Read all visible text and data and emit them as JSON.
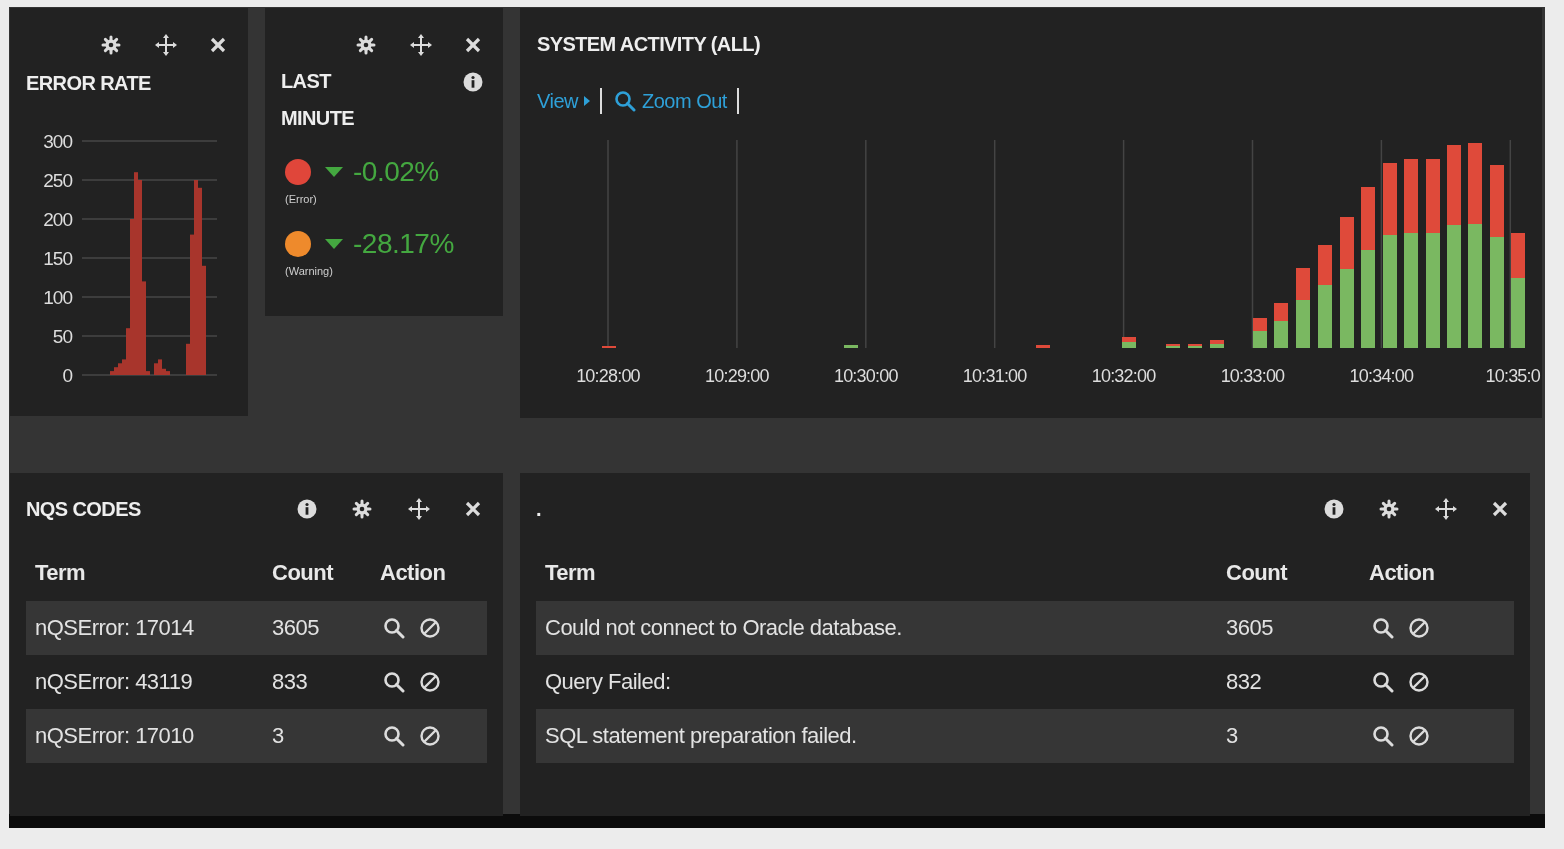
{
  "error_rate": {
    "title": "ERROR RATE",
    "chart_data": {
      "type": "bar",
      "grid": true,
      "ylim": [
        0,
        300
      ],
      "yticks": [
        0,
        50,
        100,
        150,
        200,
        250,
        300
      ],
      "values": [
        0,
        0,
        0,
        0,
        0,
        0,
        0,
        5,
        10,
        15,
        20,
        60,
        200,
        260,
        250,
        120,
        5,
        0,
        15,
        20,
        8,
        5,
        0,
        0,
        0,
        0,
        40,
        180,
        250,
        240,
        140,
        0,
        0,
        0
      ]
    }
  },
  "last_minute": {
    "title": "LAST MINUTE",
    "metrics": [
      {
        "color": "#e0463a",
        "kind": "down",
        "value": "-0.02%",
        "label": "(Error)"
      },
      {
        "color": "#ee8a2c",
        "kind": "down",
        "value": "-28.17%",
        "label": "(Warning)"
      }
    ]
  },
  "system_activity": {
    "title": "SYSTEM ACTIVITY (ALL)",
    "links": [
      {
        "label": "View",
        "kind": "menu"
      },
      {
        "label": "Zoom Out",
        "kind": "zoom"
      }
    ],
    "time_labels": [
      "10:28:00",
      "10:29:00",
      "10:30:00",
      "10:31:00",
      "10:32:00",
      "10:33:00",
      "10:34:00",
      "10:35:0"
    ]
  },
  "tables": [
    {
      "title": "NQS CODES",
      "columns": [
        "Term",
        "Count",
        "Action"
      ],
      "rows": [
        {
          "term": "nQSError: 17014",
          "count": "3605"
        },
        {
          "term": "nQSError: 43119",
          "count": "833"
        },
        {
          "term": "nQSError: 17010",
          "count": "3"
        }
      ]
    },
    {
      "title": ".",
      "columns": [
        "Term",
        "Count",
        "Action"
      ],
      "rows": [
        {
          "term": "Could not connect to Oracle database.",
          "count": "3605"
        },
        {
          "term": "Query Failed:",
          "count": "832"
        },
        {
          "term": "SQL statement preparation failed.",
          "count": "3"
        }
      ]
    }
  ]
}
